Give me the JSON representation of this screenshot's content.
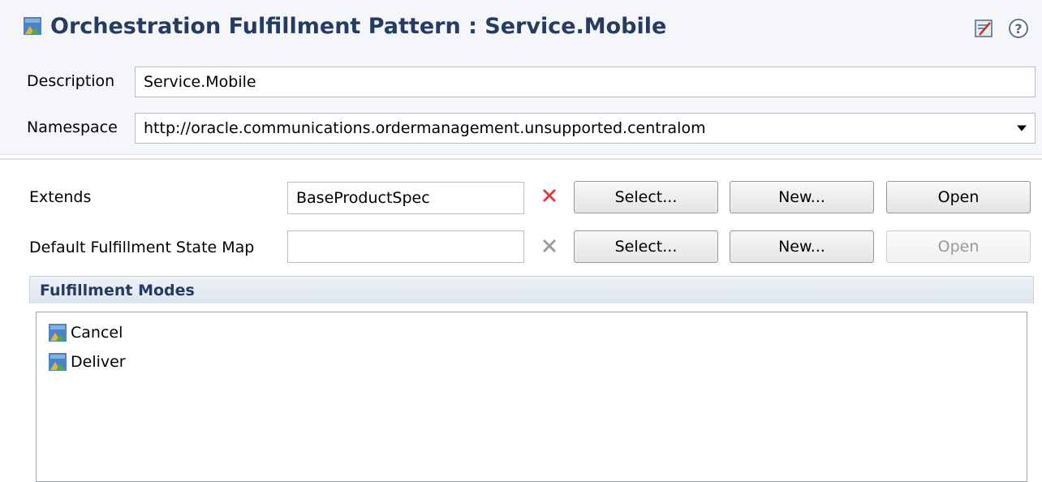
{
  "header": {
    "title": "Orchestration Fulfillment Pattern : Service.Mobile",
    "title_icon": "orchestration-pattern-icon"
  },
  "general": {
    "description_label": "Description",
    "description_value": "Service.Mobile",
    "namespace_label": "Namespace",
    "namespace_value": "http://oracle.communications.ordermanagement.unsupported.centralom"
  },
  "extends": {
    "label": "Extends",
    "value": "BaseProductSpec",
    "select_label": "Select...",
    "new_label": "New...",
    "open_label": "Open"
  },
  "state_map": {
    "label": "Default Fulfillment State Map",
    "value": "",
    "select_label": "Select...",
    "new_label": "New...",
    "open_label": "Open"
  },
  "fulfillment_modes": {
    "title": "Fulfillment Modes",
    "items": [
      {
        "label": "Cancel"
      },
      {
        "label": "Deliver"
      }
    ]
  },
  "colors": {
    "title": "#243c64",
    "clear_active": "#e03a3a",
    "clear_inactive": "#9a9a9a"
  }
}
